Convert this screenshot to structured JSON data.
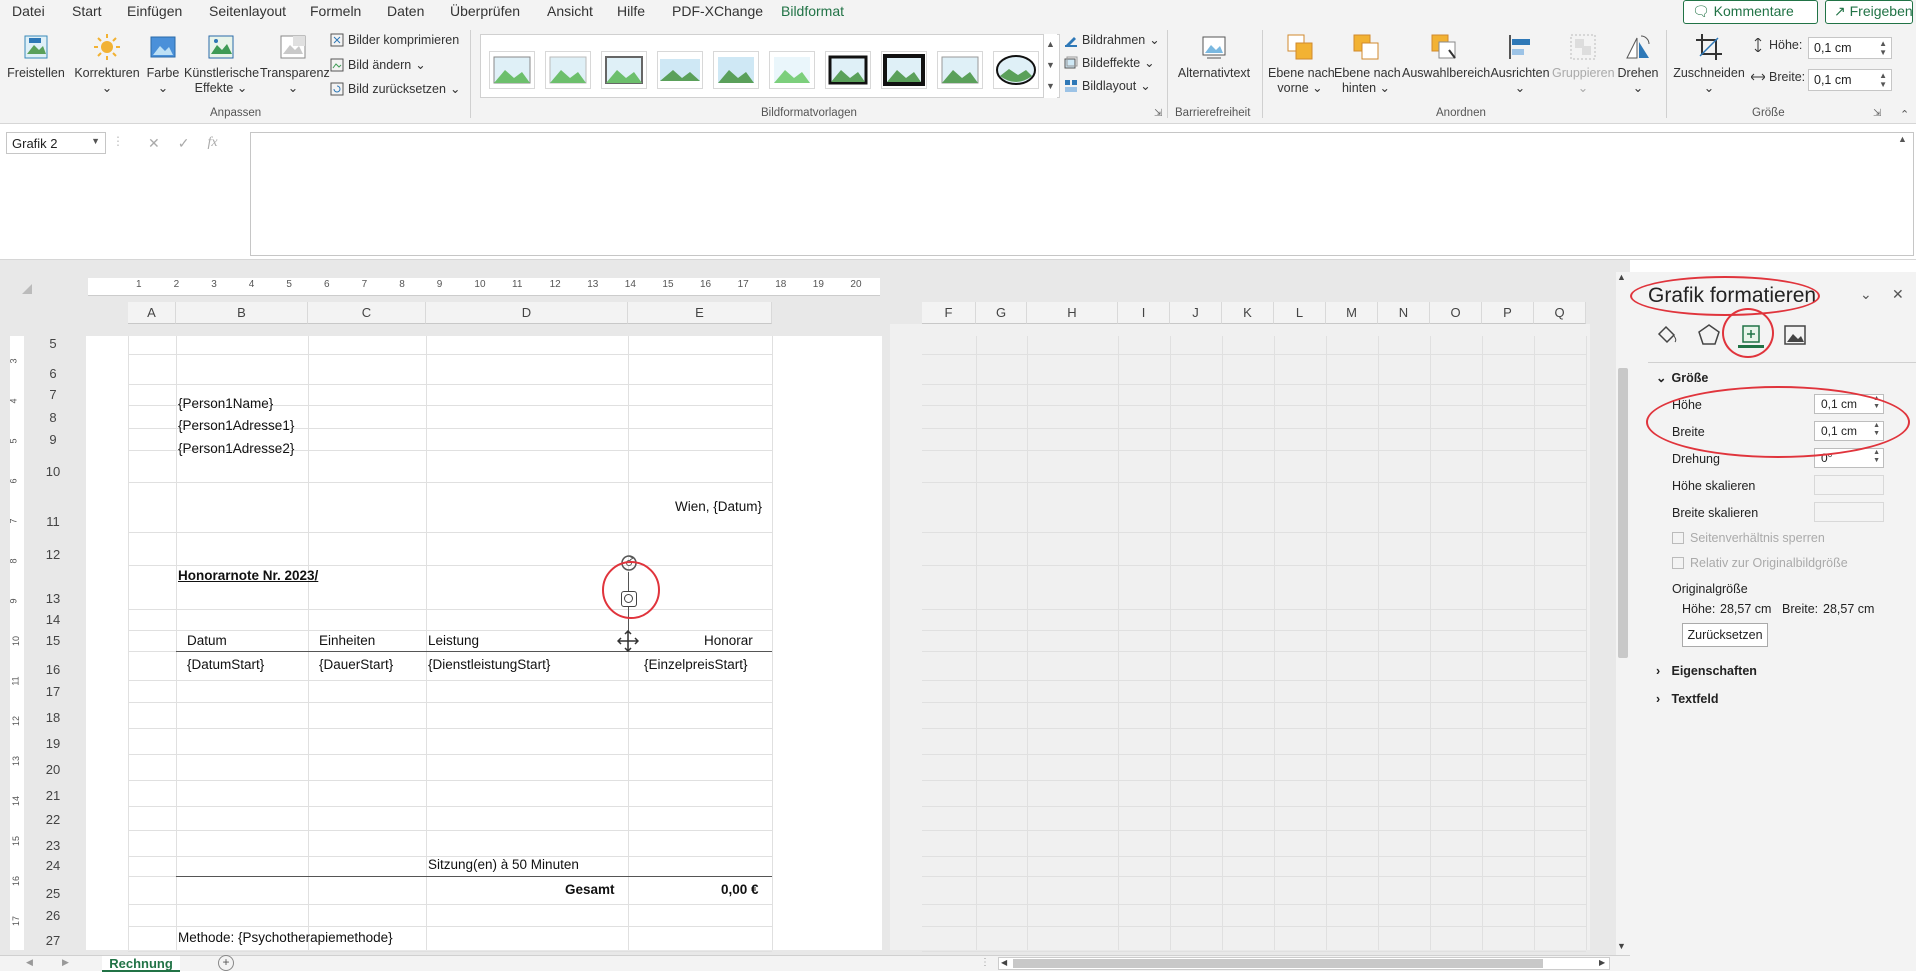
{
  "menu": {
    "tabs": [
      "Datei",
      "Start",
      "Einfügen",
      "Seitenlayout",
      "Formeln",
      "Daten",
      "Überprüfen",
      "Ansicht",
      "Hilfe",
      "PDF-XChange",
      "Bildformat"
    ],
    "active": "Bildformat",
    "comments": "Kommentare",
    "share": "Freigeben"
  },
  "ribbon": {
    "freistellen": "Freistellen",
    "korrekturen": "Korrekturen",
    "farbe": "Farbe",
    "kuenstlerisch1": "Künstlerische",
    "kuenstlerisch2": "Effekte",
    "transparenz": "Transparenz",
    "komprimieren": "Bilder komprimieren",
    "aendern": "Bild ändern",
    "zuruecksetzen": "Bild zurücksetzen",
    "grp_anpassen": "Anpassen",
    "bildrahmen": "Bildrahmen",
    "bildeffekte": "Bildeffekte",
    "bildlayout": "Bildlayout",
    "grp_vorlagen": "Bildformatvorlagen",
    "alternativtext": "Alternativtext",
    "grp_barriere": "Barrierefreiheit",
    "ebene_vorne1": "Ebene nach",
    "ebene_vorne2": "vorne",
    "ebene_hinten1": "Ebene nach",
    "ebene_hinten2": "hinten",
    "auswahlbereich": "Auswahlbereich",
    "ausrichten": "Ausrichten",
    "gruppieren": "Gruppieren",
    "drehen": "Drehen",
    "grp_anordnen": "Anordnen",
    "zuschneiden": "Zuschneiden",
    "hoehe_label": "Höhe:",
    "hoehe_val": "0,1 cm",
    "breite_label": "Breite:",
    "breite_val": "0,1 cm",
    "grp_groesse": "Größe"
  },
  "formula": {
    "namebox": "Grafik 2",
    "fx": "fx"
  },
  "sheet": {
    "columns": [
      "A",
      "B",
      "C",
      "D",
      "E",
      "F",
      "G",
      "H",
      "I",
      "J",
      "K",
      "L",
      "M",
      "N",
      "O",
      "P",
      "Q"
    ],
    "rows": [
      "5",
      "6",
      "7",
      "8",
      "9",
      "10",
      "11",
      "12",
      "13",
      "14",
      "15",
      "16",
      "17",
      "18",
      "19",
      "20",
      "21",
      "22",
      "23",
      "24",
      "25",
      "26",
      "27"
    ],
    "ruler": [
      "1",
      "2",
      "3",
      "4",
      "5",
      "6",
      "7",
      "8",
      "9",
      "10",
      "11",
      "12",
      "13",
      "14",
      "15",
      "16",
      "17",
      "18",
      "19",
      "20"
    ],
    "vruler": [
      "3",
      "4",
      "5",
      "6",
      "7",
      "8",
      "9",
      "10",
      "11",
      "12",
      "13",
      "14",
      "15",
      "16",
      "17"
    ],
    "person_name": "{Person1Name}",
    "adresse1": "{Person1Adresse1}",
    "adresse2": "{Person1Adresse2}",
    "datum": "Wien, {Datum}",
    "honorarnote": "Honorarnote Nr. 2023/",
    "h_datum": "Datum",
    "h_einheiten": "Einheiten",
    "h_leistung": "Leistung",
    "h_honorar": "Honorar",
    "v_datum": "{DatumStart}",
    "v_dauer": "{DauerStart}",
    "v_dienst": "{DienstleistungStart}",
    "v_preis": "{EinzelpreisStart}",
    "sitzung": "Sitzung(en) à 50 Minuten",
    "gesamt": "Gesamt",
    "gesamt_val": "0,00 €",
    "methode": "Methode: {Psychotherapiemethode}",
    "sheet_tab": "Rechnung"
  },
  "pane": {
    "title": "Grafik formatieren",
    "section_size": "Größe",
    "hoehe": "Höhe",
    "hoehe_val": "0,1 cm",
    "breite": "Breite",
    "breite_val": "0,1 cm",
    "drehung": "Drehung",
    "drehung_val": "0°",
    "hoehe_skal": "Höhe skalieren",
    "breite_skal": "Breite skalieren",
    "chk1": "Seitenverhältnis sperren",
    "chk2": "Relativ zur Originalbildgröße",
    "original": "Originalgröße",
    "orig_h_label": "Höhe:",
    "orig_h": "28,57 cm",
    "orig_b_label": "Breite:",
    "orig_b": "28,57 cm",
    "reset": "Zurücksetzen",
    "eigenschaften": "Eigenschaften",
    "textfeld": "Textfeld"
  },
  "colors": {
    "accent": "#217346",
    "highlight": "#e0343c"
  }
}
